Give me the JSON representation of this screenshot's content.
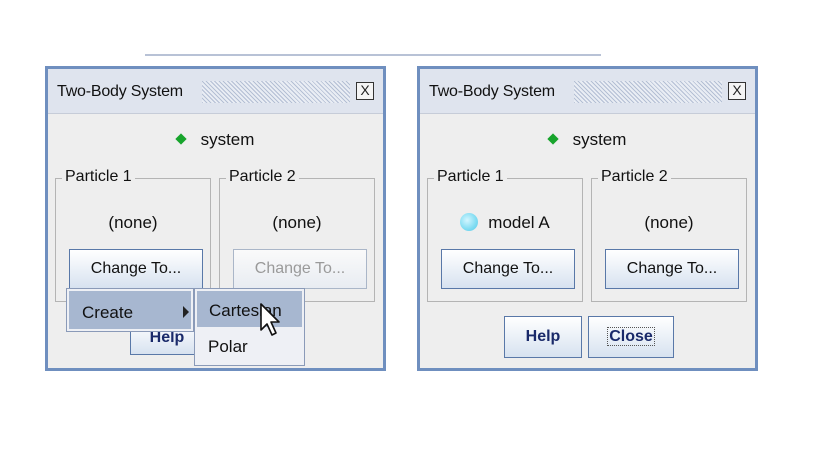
{
  "left_dialog": {
    "title": "Two-Body System",
    "close_glyph": "X",
    "system_label": "system",
    "particle1": {
      "legend": "Particle 1",
      "value": "(none)",
      "button": "Change To..."
    },
    "particle2": {
      "legend": "Particle 2",
      "value": "(none)",
      "button": "Change To..."
    },
    "help_label": "Help",
    "menu": {
      "create_label": "Create"
    },
    "submenu": {
      "items": [
        "Cartesian",
        "Polar"
      ]
    }
  },
  "right_dialog": {
    "title": "Two-Body System",
    "close_glyph": "X",
    "system_label": "system",
    "particle1": {
      "legend": "Particle 1",
      "value": "model A",
      "button": "Change To..."
    },
    "particle2": {
      "legend": "Particle 2",
      "value": "(none)",
      "button": "Change To..."
    },
    "help_label": "Help",
    "close_label": "Close"
  },
  "colors": {
    "frame": "#6f8fbf",
    "system_icon": "#17a42c",
    "model_icon": "#7fdcf2",
    "menu_highlight": "#a7b7d0"
  },
  "icons": {
    "system": "green-diamond-icon",
    "model": "cyan-sphere-icon",
    "cursor": "arrow-cursor-icon",
    "submenu_arrow": "triangle-right-icon"
  }
}
